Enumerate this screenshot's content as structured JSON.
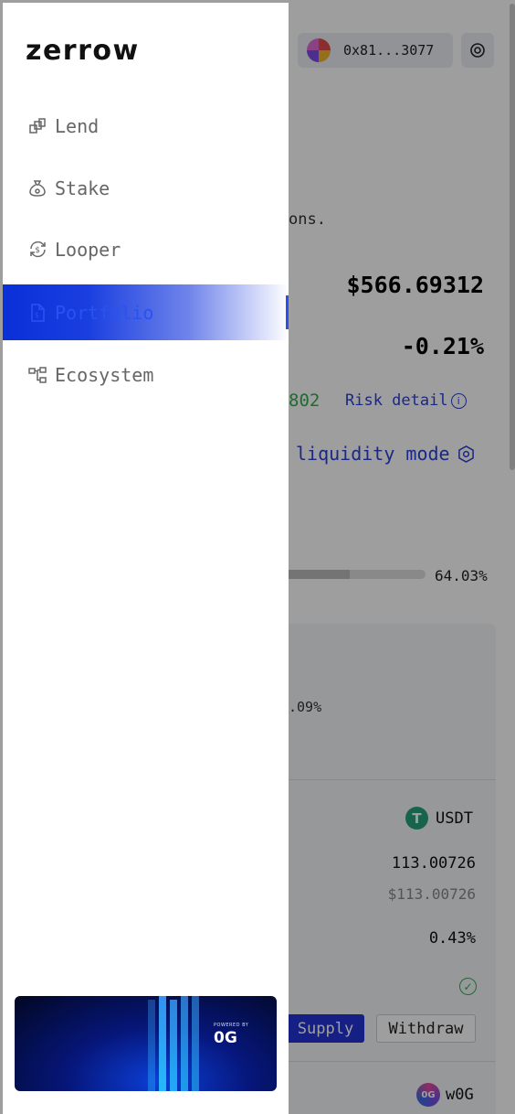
{
  "app": {
    "logo": "zerrow"
  },
  "wallet": {
    "address": "0x81...3077"
  },
  "nav": {
    "items": [
      {
        "label": "Lend",
        "icon": "lend-icon"
      },
      {
        "label": "Stake",
        "icon": "stake-icon"
      },
      {
        "label": "Looper",
        "icon": "looper-icon"
      },
      {
        "label": "Portfolio",
        "icon": "portfolio-icon",
        "active": true
      },
      {
        "label": "Ecosystem",
        "icon": "ecosystem-icon"
      }
    ]
  },
  "banner": {
    "powered_by": "POWERED BY",
    "brand": "0G"
  },
  "background": {
    "snippet_text": "ons.",
    "net_worth": "$566.69312",
    "net_apy": "-0.21%",
    "health_value_fragment": "802",
    "risk_detail": "Risk detail",
    "liquidity_mode": "liquidity mode",
    "health_percent": "64.03%",
    "health_fill_fraction": 0.6403,
    "card_percent_fragment": ".09%",
    "asset1": {
      "token": "USDT",
      "balance": "113.00726",
      "balance_usd": "$113.00726",
      "apy": "0.43%",
      "supply_label": "Supply",
      "withdraw_label": "Withdraw"
    },
    "asset2": {
      "token": "w0G"
    }
  },
  "colors": {
    "accent": "#2233d6",
    "active_nav": "#2a52f0",
    "positive": "#2fae4f"
  }
}
